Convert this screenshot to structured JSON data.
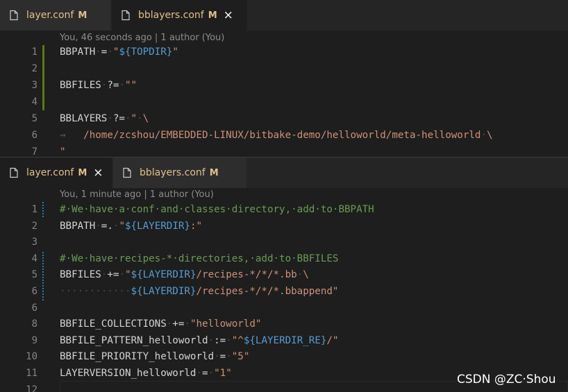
{
  "top_pane": {
    "tabs": [
      {
        "label": "layer.conf",
        "modified": "M",
        "active": false
      },
      {
        "label": "bblayers.conf",
        "modified": "M",
        "active": true,
        "close": "×"
      }
    ],
    "blame": "You, 46 seconds ago | 1 author (You)",
    "lines": [
      {
        "n": "1",
        "tokens": [
          [
            "k",
            "BBPATH"
          ],
          [
            "w",
            "·"
          ],
          [
            "k",
            "="
          ],
          [
            "w",
            "·"
          ],
          [
            "s",
            "\""
          ],
          [
            "v",
            "${TOPDIR}"
          ],
          [
            "s",
            "\""
          ]
        ]
      },
      {
        "n": "2",
        "tokens": []
      },
      {
        "n": "3",
        "tokens": [
          [
            "k",
            "BBFILES"
          ],
          [
            "w",
            "·"
          ],
          [
            "k",
            "?="
          ],
          [
            "w",
            "·"
          ],
          [
            "s",
            "\"\""
          ]
        ]
      },
      {
        "n": "4",
        "tokens": []
      },
      {
        "n": "5",
        "tokens": [
          [
            "k",
            "BBLAYERS"
          ],
          [
            "w",
            "·"
          ],
          [
            "k",
            "?="
          ],
          [
            "w",
            "·"
          ],
          [
            "s",
            "\""
          ],
          [
            "w",
            "·"
          ],
          [
            "s",
            "\\"
          ]
        ]
      },
      {
        "n": "6",
        "tokens": [
          [
            "t",
            "→"
          ],
          [
            "k",
            "   "
          ],
          [
            "s",
            "/home/zcshou/EMBEDDED-LINUX/bitbake-demo/helloworld/meta-helloworld"
          ],
          [
            "w",
            "·"
          ],
          [
            "s",
            "\\"
          ]
        ]
      },
      {
        "n": "7",
        "tokens": [
          [
            "s",
            "\""
          ]
        ]
      }
    ]
  },
  "bottom_pane": {
    "tabs": [
      {
        "label": "layer.conf",
        "modified": "M",
        "active": true,
        "close": "×"
      },
      {
        "label": "bblayers.conf",
        "modified": "M",
        "active": false
      }
    ],
    "blame": "You, 1 minute ago | 1 author (You)",
    "lines": [
      {
        "n": "1",
        "tokens": [
          [
            "c",
            "#·We·have·a·conf·and·classes·directory,·add·to·BBPATH"
          ]
        ]
      },
      {
        "n": "2",
        "tokens": [
          [
            "k",
            "BBPATH"
          ],
          [
            "w",
            "·"
          ],
          [
            "k",
            "=."
          ],
          [
            "w",
            "·"
          ],
          [
            "s",
            "\""
          ],
          [
            "v",
            "${LAYERDIR}"
          ],
          [
            "s",
            ":\""
          ]
        ]
      },
      {
        "n": "3",
        "tokens": []
      },
      {
        "n": "4",
        "tokens": [
          [
            "c",
            "#·We·have·recipes-*·directories,·add·to·BBFILES"
          ]
        ]
      },
      {
        "n": "5",
        "tokens": [
          [
            "k",
            "BBFILES"
          ],
          [
            "w",
            "·"
          ],
          [
            "k",
            "+="
          ],
          [
            "w",
            "·"
          ],
          [
            "s",
            "\""
          ],
          [
            "v",
            "${LAYERDIR}"
          ],
          [
            "s",
            "/recipes-*/*/*.bb"
          ],
          [
            "w",
            "·"
          ],
          [
            "s",
            "\\"
          ]
        ]
      },
      {
        "n": "6",
        "tokens": [
          [
            "w",
            "············"
          ],
          [
            "v",
            "${LAYERDIR}"
          ],
          [
            "s",
            "/recipes-*/*/*.bbappend\""
          ]
        ]
      },
      {
        "n": "6",
        "tokens": []
      },
      {
        "n": "8",
        "tokens": [
          [
            "k",
            "BBFILE_COLLECTIONS"
          ],
          [
            "w",
            "·"
          ],
          [
            "k",
            "+="
          ],
          [
            "w",
            "·"
          ],
          [
            "s",
            "\"helloworld\""
          ]
        ]
      },
      {
        "n": "9",
        "tokens": [
          [
            "k",
            "BBFILE_PATTERN_helloworld"
          ],
          [
            "w",
            "·"
          ],
          [
            "k",
            ":="
          ],
          [
            "w",
            "·"
          ],
          [
            "s",
            "\"^"
          ],
          [
            "v",
            "${LAYERDIR_RE}"
          ],
          [
            "s",
            "/\""
          ]
        ]
      },
      {
        "n": "10",
        "tokens": [
          [
            "k",
            "BBFILE_PRIORITY_helloworld"
          ],
          [
            "w",
            "·"
          ],
          [
            "k",
            "="
          ],
          [
            "w",
            "·"
          ],
          [
            "s",
            "\"5\""
          ]
        ]
      },
      {
        "n": "11",
        "tokens": [
          [
            "k",
            "LAYERVERSION_helloworld"
          ],
          [
            "w",
            "·"
          ],
          [
            "k",
            "="
          ],
          [
            "w",
            "·"
          ],
          [
            "s",
            "\"1\""
          ]
        ]
      },
      {
        "n": "12",
        "tokens": []
      }
    ]
  },
  "watermark": "CSDN @ZC·Shou",
  "colors": {
    "keyword": "#d4d4d4",
    "string": "#ce9178",
    "variable": "#569cd6",
    "comment": "#6a9955",
    "modified_tab_label": "#e2c08d",
    "gutter_added": "#587c0c",
    "gutter_modified": "#1b81a8"
  },
  "icons": [
    "file-icon",
    "close-icon"
  ]
}
